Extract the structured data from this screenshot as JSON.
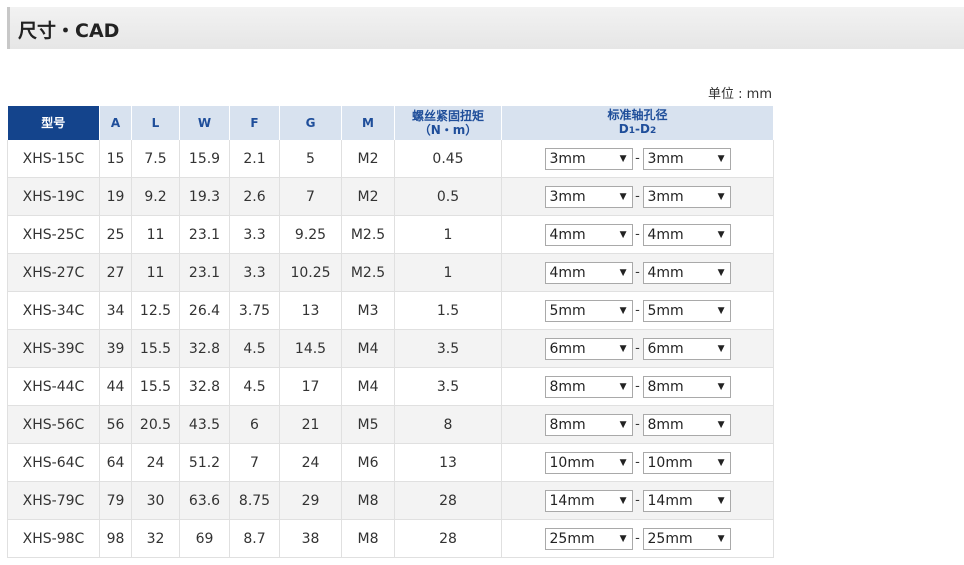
{
  "page": {
    "section_title": "尺寸・CAD",
    "unit_note": "单位 : mm"
  },
  "table": {
    "headers": {
      "model": "型号",
      "A": "A",
      "L": "L",
      "W": "W",
      "F": "F",
      "G": "G",
      "M": "M",
      "torque_line1": "螺丝紧固扭矩",
      "torque_line2": "（N・m）",
      "bore_line1": "标准轴孔径",
      "bore_d": "D",
      "bore_sub1": "1",
      "bore_sep": "-D",
      "bore_sub2": "2"
    },
    "separator": "-",
    "dropdown_arrow": "▼",
    "rows": [
      {
        "model": "XHS-15C",
        "A": "15",
        "L": "7.5",
        "W": "15.9",
        "F": "2.1",
        "G": "5",
        "M": "M2",
        "torque": "0.45",
        "d1": "3mm",
        "d2": "3mm"
      },
      {
        "model": "XHS-19C",
        "A": "19",
        "L": "9.2",
        "W": "19.3",
        "F": "2.6",
        "G": "7",
        "M": "M2",
        "torque": "0.5",
        "d1": "3mm",
        "d2": "3mm"
      },
      {
        "model": "XHS-25C",
        "A": "25",
        "L": "11",
        "W": "23.1",
        "F": "3.3",
        "G": "9.25",
        "M": "M2.5",
        "torque": "1",
        "d1": "4mm",
        "d2": "4mm"
      },
      {
        "model": "XHS-27C",
        "A": "27",
        "L": "11",
        "W": "23.1",
        "F": "3.3",
        "G": "10.25",
        "M": "M2.5",
        "torque": "1",
        "d1": "4mm",
        "d2": "4mm"
      },
      {
        "model": "XHS-34C",
        "A": "34",
        "L": "12.5",
        "W": "26.4",
        "F": "3.75",
        "G": "13",
        "M": "M3",
        "torque": "1.5",
        "d1": "5mm",
        "d2": "5mm"
      },
      {
        "model": "XHS-39C",
        "A": "39",
        "L": "15.5",
        "W": "32.8",
        "F": "4.5",
        "G": "14.5",
        "M": "M4",
        "torque": "3.5",
        "d1": "6mm",
        "d2": "6mm"
      },
      {
        "model": "XHS-44C",
        "A": "44",
        "L": "15.5",
        "W": "32.8",
        "F": "4.5",
        "G": "17",
        "M": "M4",
        "torque": "3.5",
        "d1": "8mm",
        "d2": "8mm"
      },
      {
        "model": "XHS-56C",
        "A": "56",
        "L": "20.5",
        "W": "43.5",
        "F": "6",
        "G": "21",
        "M": "M5",
        "torque": "8",
        "d1": "8mm",
        "d2": "8mm"
      },
      {
        "model": "XHS-64C",
        "A": "64",
        "L": "24",
        "W": "51.2",
        "F": "7",
        "G": "24",
        "M": "M6",
        "torque": "13",
        "d1": "10mm",
        "d2": "10mm"
      },
      {
        "model": "XHS-79C",
        "A": "79",
        "L": "30",
        "W": "63.6",
        "F": "8.75",
        "G": "29",
        "M": "M8",
        "torque": "28",
        "d1": "14mm",
        "d2": "14mm"
      },
      {
        "model": "XHS-98C",
        "A": "98",
        "L": "32",
        "W": "69",
        "F": "8.7",
        "G": "38",
        "M": "M8",
        "torque": "28",
        "d1": "25mm",
        "d2": "25mm"
      }
    ]
  }
}
